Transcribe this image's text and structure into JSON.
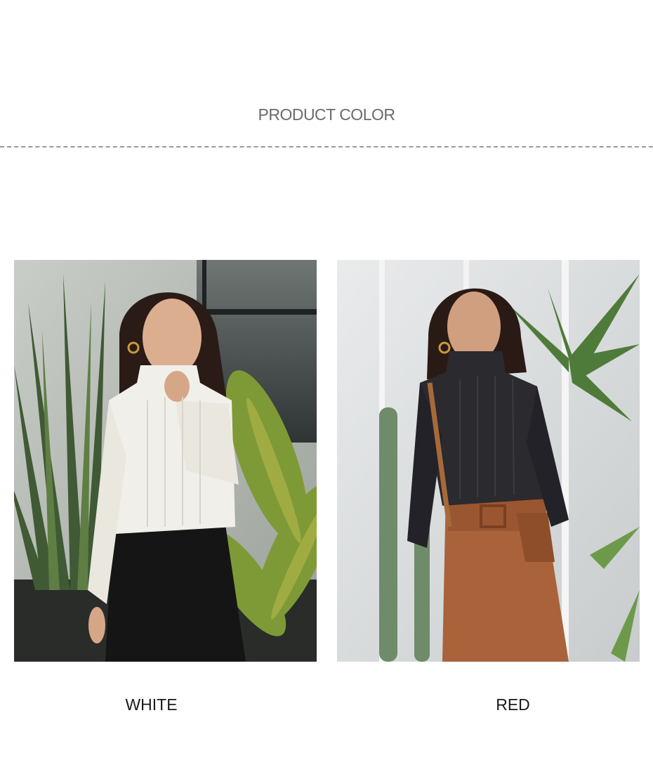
{
  "section": {
    "title": "PRODUCT COLOR"
  },
  "colors": [
    {
      "label": "WHITE",
      "swatch": "#f3f1ec",
      "icon": "white-turtleneck-photo"
    },
    {
      "label": "RED",
      "swatch": "#2b2a2f",
      "icon": "dark-turtleneck-photo"
    }
  ]
}
